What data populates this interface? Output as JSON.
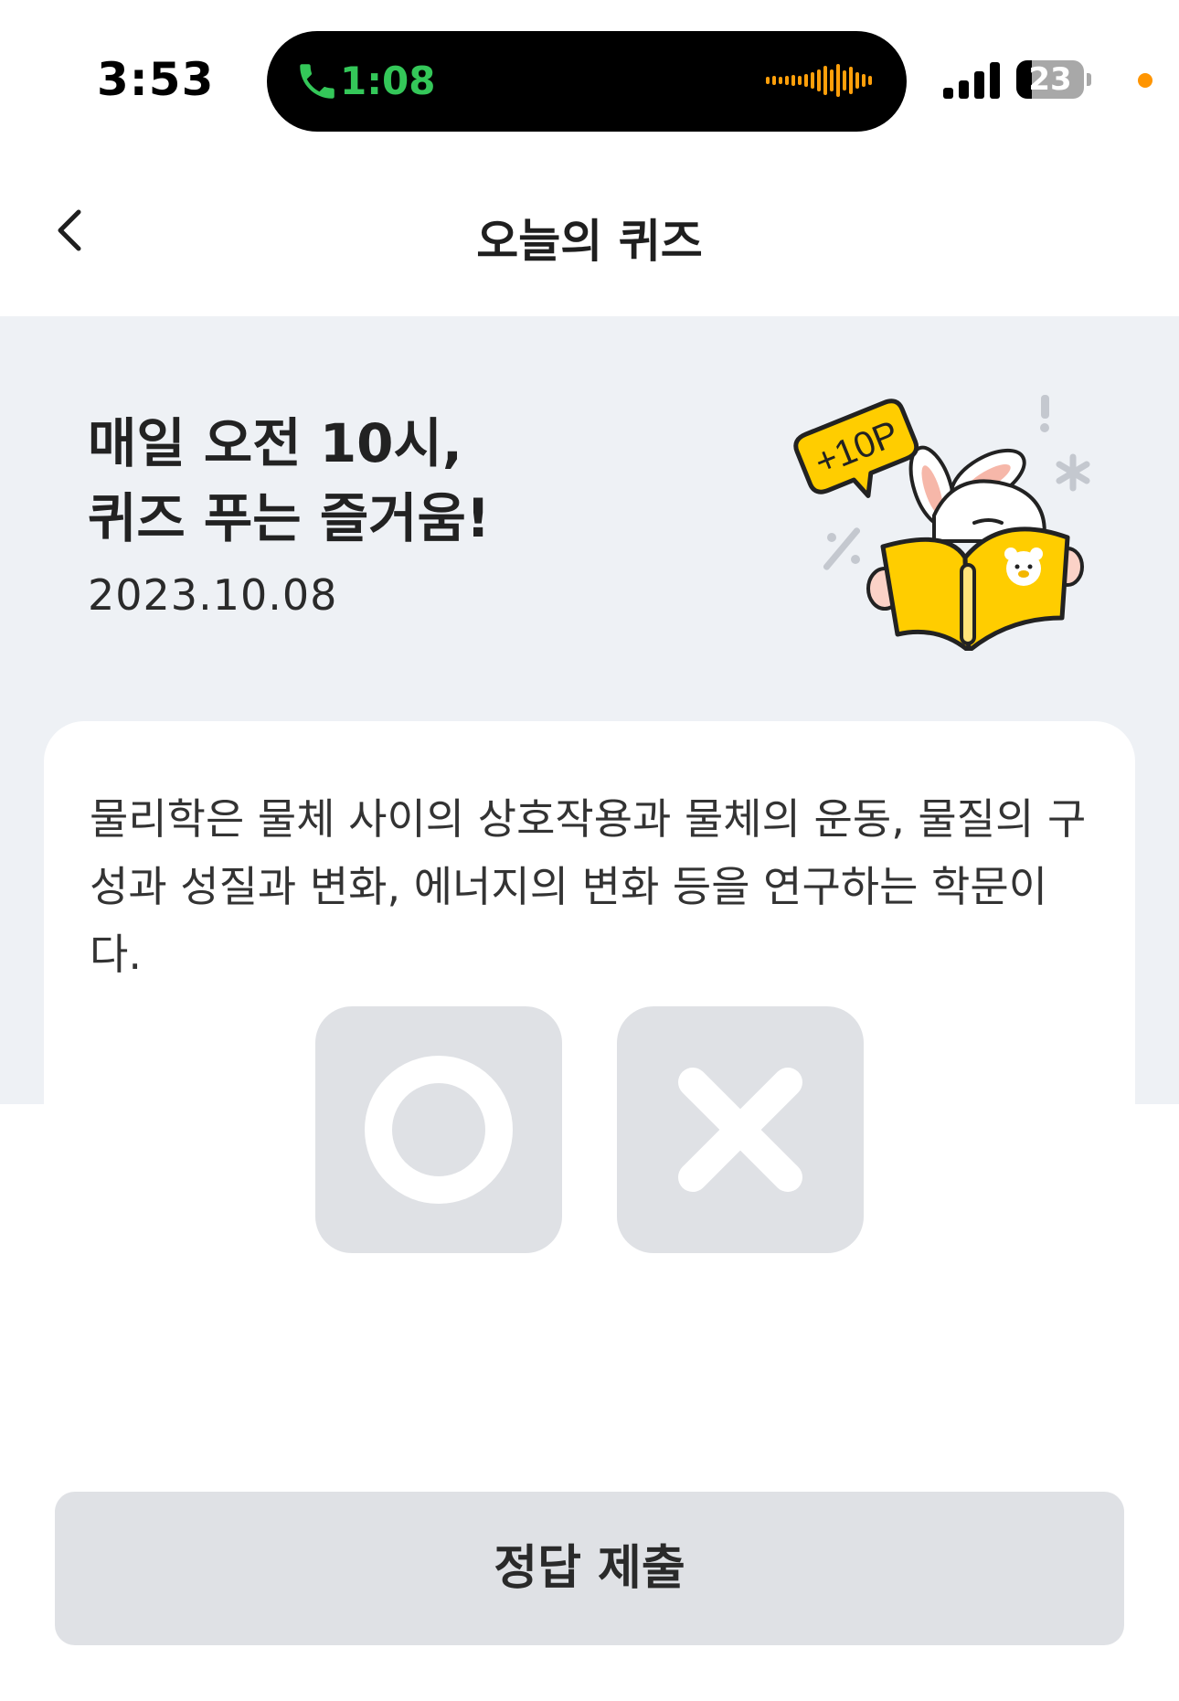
{
  "status_bar": {
    "time": "3:53",
    "call_timer": "1:08",
    "battery_level": "23",
    "battery_percent": 23,
    "colors": {
      "call_green": "#34c759",
      "waveform_orange": "#ff9f0a",
      "privacy_dot": "#ff9500"
    }
  },
  "nav": {
    "title": "오늘의 퀴즈",
    "back_icon": "chevron-left-icon"
  },
  "hero": {
    "headline_line1": "매일 오전 10시,",
    "headline_line2": "퀴즈 푸는 즐거움!",
    "date": "2023.10.08",
    "badge_text": "+10P",
    "illustration": "rabbit-reading-book-illustration",
    "colors": {
      "background": "#eef1f5",
      "book_yellow": "#ffcd00"
    }
  },
  "quiz": {
    "question": "물리학은 물체 사이의 상호작용과 물체의 운동, 물질의 구성과 성질과 변화, 에너지의 변화 등을 연구하는 학문이다.",
    "option_true_icon": "circle-o-icon",
    "option_false_icon": "cross-x-icon"
  },
  "submit": {
    "label": "정답 제출"
  }
}
